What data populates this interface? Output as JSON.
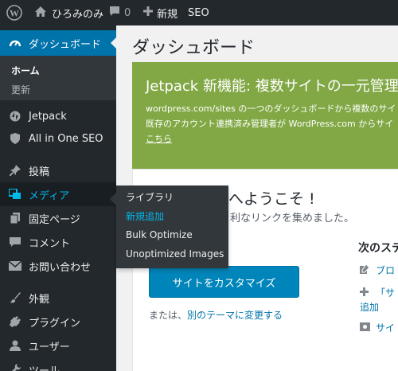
{
  "adminbar": {
    "wp_icon": "wordpress-logo-icon",
    "site_icon": "home-icon",
    "site_name": "ひろみのみ",
    "comments_icon": "comment-bubble-icon",
    "comments_count": "0",
    "new_icon": "plus-icon",
    "new_label": "新規",
    "seo_label": "SEO"
  },
  "sidebar": {
    "dashboard": {
      "label": "ダッシュボード",
      "icon": "gauge-icon"
    },
    "dashboard_submenu": {
      "home": "ホーム",
      "updates": "更新"
    },
    "items": [
      {
        "label": "Jetpack",
        "icon": "jetpack-icon"
      },
      {
        "label": "All in One SEO",
        "icon": "shield-icon"
      },
      {
        "label": "投稿",
        "icon": "pin-icon"
      },
      {
        "label": "メディア",
        "icon": "media-icon"
      },
      {
        "label": "固定ページ",
        "icon": "page-icon"
      },
      {
        "label": "コメント",
        "icon": "comment-icon"
      },
      {
        "label": "お問い合わせ",
        "icon": "mail-icon"
      },
      {
        "label": "外観",
        "icon": "paintbrush-icon"
      },
      {
        "label": "プラグイン",
        "icon": "plug-icon"
      },
      {
        "label": "ユーザー",
        "icon": "user-icon"
      },
      {
        "label": "ツール",
        "icon": "wrench-icon"
      }
    ]
  },
  "media_flyout": {
    "items": [
      "ライブラリ",
      "新規追加",
      "Bulk Optimize",
      "Unoptimized Images"
    ],
    "active": "新規追加"
  },
  "main": {
    "page_title": "ダッシュボード",
    "jetpack_banner": {
      "title": "Jetpack 新機能: 複数サイトの一元管理",
      "line1": "wordpress.com/sites の一つのダッシュボードから複数のサイ",
      "line2": "既存のアカウント連携済み管理者が WordPress.com からサイ",
      "link": "こちら"
    },
    "welcome": {
      "title": "へようこそ !",
      "subtitle": "利なリンクを集めました。",
      "customize_button": "サイトをカスタマイズ",
      "alt_prefix": "または、",
      "alt_link": "別のテーマに変更する",
      "next_steps_title": "次のステ",
      "steps": [
        {
          "icon": "edit-icon",
          "text": "ブロ"
        },
        {
          "icon": "plus-icon",
          "text": "「サ"
        },
        {
          "icon": "",
          "text": "追加"
        },
        {
          "icon": "view-icon",
          "text": "サイ"
        }
      ]
    }
  },
  "colors": {
    "adminbar_bg": "#23282d",
    "sidebar_bg": "#23282d",
    "accent_blue": "#0073aa",
    "active_text": "#00b9eb",
    "jetpack_green": "#81a844",
    "button_blue": "#0085ba"
  }
}
